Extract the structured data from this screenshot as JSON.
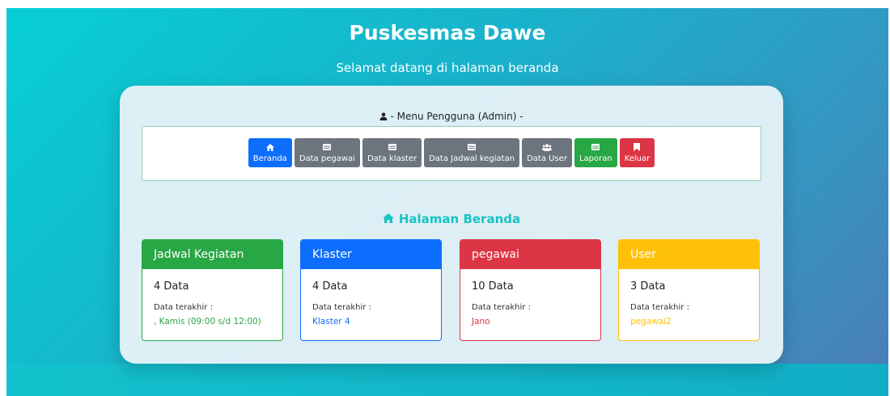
{
  "header": {
    "title": "Puskesmas Dawe",
    "subtitle": "Selamat datang di halaman beranda"
  },
  "menu": {
    "title": "- Menu Pengguna (Admin) -",
    "icon": "user-icon",
    "buttons": [
      {
        "label": "Beranda",
        "icon": "home-icon",
        "color": "#0d6efd"
      },
      {
        "label": "Data pegawai",
        "icon": "table-icon",
        "color": "#6c757d"
      },
      {
        "label": "Data klaster",
        "icon": "table-icon",
        "color": "#6c757d"
      },
      {
        "label": "Data Jadwal kegiatan",
        "icon": "table-icon",
        "color": "#6c757d"
      },
      {
        "label": "Data User",
        "icon": "users-icon",
        "color": "#6c757d"
      },
      {
        "label": "Laporan",
        "icon": "table-icon",
        "color": "#28a745"
      },
      {
        "label": "Keluar",
        "icon": "bookmark-icon",
        "color": "#dc3545"
      }
    ]
  },
  "section": {
    "title": "Halaman Beranda",
    "icon": "home-icon",
    "color": "#17c3c3"
  },
  "cards": [
    {
      "title": "Jadwal Kegiatan",
      "count": "4 Data",
      "last_label": "Data terakhir :",
      "last_value": ", Kamis (09:00 s/d 12:00)",
      "color": "#28a745"
    },
    {
      "title": "Klaster",
      "count": "4 Data",
      "last_label": "Data terakhir :",
      "last_value": "Klaster 4",
      "color": "#0d6efd"
    },
    {
      "title": "pegawai",
      "count": "10 Data",
      "last_label": "Data terakhir :",
      "last_value": "Jano",
      "color": "#dc3545"
    },
    {
      "title": "User",
      "count": "3 Data",
      "last_label": "Data terakhir :",
      "last_value": "pegawai2",
      "color": "#ffc107"
    }
  ]
}
